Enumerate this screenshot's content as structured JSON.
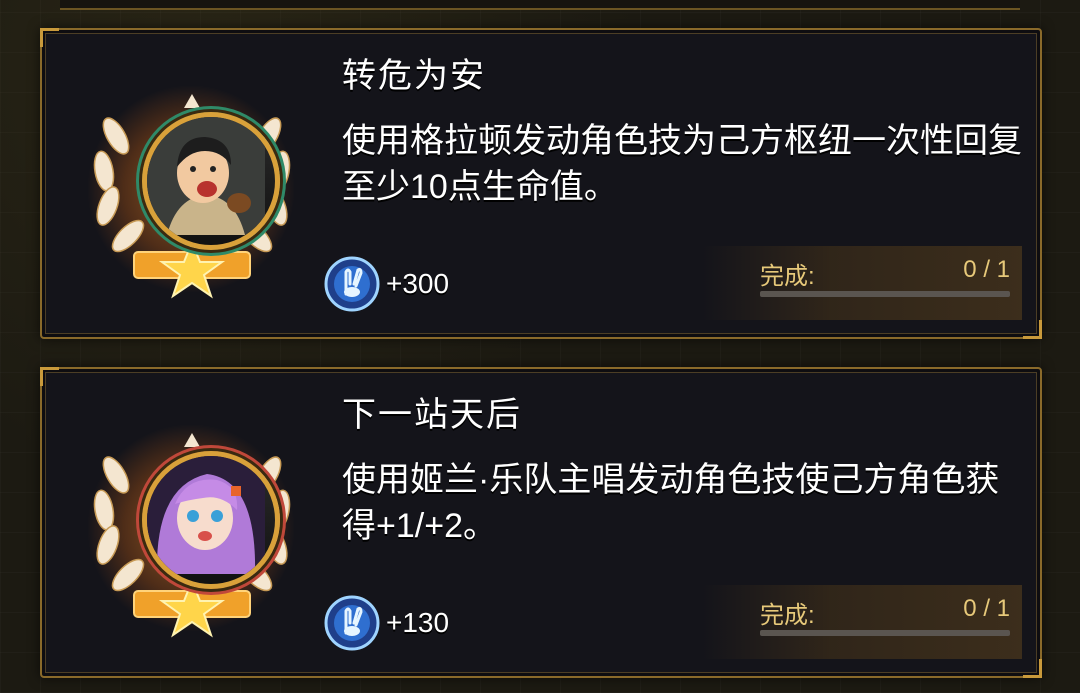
{
  "achievements": [
    {
      "title": "转危为安",
      "description": "使用格拉顿发动角色技为己方枢纽一次性回复至少10点生命值。",
      "reward": "+300",
      "progress_label": "完成:",
      "progress_count": "0 / 1",
      "progress_fraction": 0,
      "portrait": "man-portrait-icon"
    },
    {
      "title": "下一站天后",
      "description": "使用姬兰·乐队主唱发动角色技使己方角色获得+1/+2。",
      "reward": "+130",
      "progress_label": "完成:",
      "progress_count": "0 / 1",
      "progress_fraction": 0,
      "portrait": "purple-hair-girl-portrait-icon"
    }
  ],
  "colors": {
    "border_gold": "#8a6a2a",
    "progress_text": "#e7c97a",
    "card_bg": "#14141a"
  }
}
